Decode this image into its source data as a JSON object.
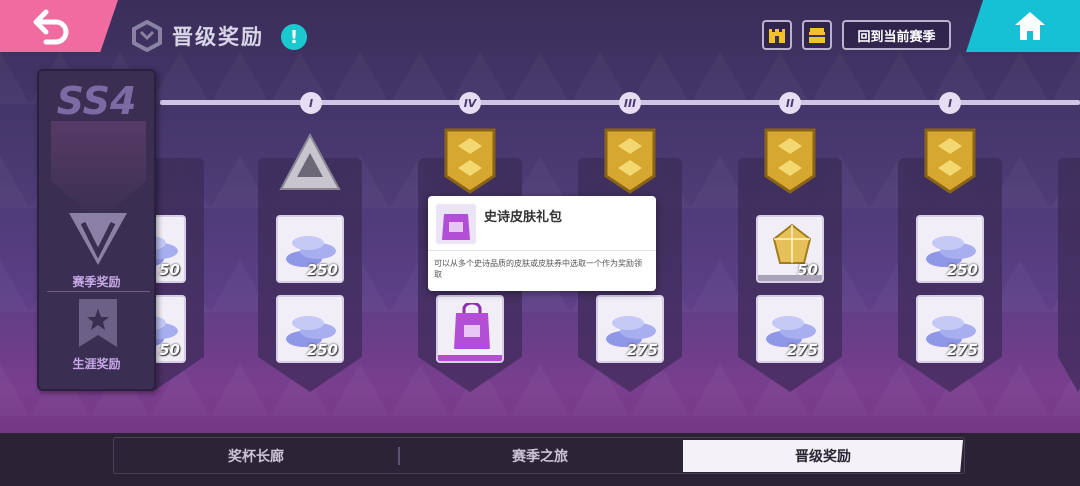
{
  "header": {
    "title": "晋级奖励",
    "info_icon": "!",
    "back_icon": "back-arrow-icon",
    "home_icon": "home-icon",
    "season_button_label": "回到当前赛季"
  },
  "side_panel": {
    "season_code": "SS4",
    "season_rewards_label": "赛季奖励",
    "career_rewards_label": "生涯奖励"
  },
  "track": {
    "rank_marks": [
      "I",
      "IV",
      "III",
      "II",
      "I"
    ]
  },
  "columns": [
    {
      "badge": "silver-star-badge",
      "rewards": [
        {
          "item": "coins",
          "amount": "50"
        },
        {
          "item": "coins",
          "amount": "50"
        }
      ]
    },
    {
      "badge": "silver-star-badge",
      "rewards": [
        {
          "item": "coins",
          "amount": "250"
        },
        {
          "item": "coins",
          "amount": "250"
        }
      ]
    },
    {
      "badge": "gold-shield-badge",
      "rewards": [
        {
          "item": "coins",
          "amount": ""
        },
        {
          "item": "epic-skin-pack",
          "amount": ""
        }
      ]
    },
    {
      "badge": "gold-shield-badge",
      "rewards": [
        {
          "item": "coins",
          "amount": ""
        },
        {
          "item": "coins",
          "amount": "275"
        }
      ]
    },
    {
      "badge": "gold-shield-badge",
      "rewards": [
        {
          "item": "gold-crystal",
          "amount": "50"
        },
        {
          "item": "coins",
          "amount": "275"
        }
      ]
    },
    {
      "badge": "gold-shield-badge",
      "rewards": [
        {
          "item": "coins",
          "amount": "250"
        },
        {
          "item": "coins",
          "amount": "275"
        }
      ]
    }
  ],
  "tooltip": {
    "title": "史诗皮肤礼包",
    "description": "可以从多个史诗品质的皮肤或皮肤券中选取一个作为奖励领取"
  },
  "tabs": [
    {
      "label": "奖杯长廊",
      "active": false
    },
    {
      "label": "赛季之旅",
      "active": false
    },
    {
      "label": "晋级奖励",
      "active": true
    }
  ],
  "colors": {
    "back_button": "#f06ca0",
    "home_button": "#16c1d6",
    "info_icon": "#19c9cf",
    "skin_pack_purple": "#b24fd6"
  }
}
